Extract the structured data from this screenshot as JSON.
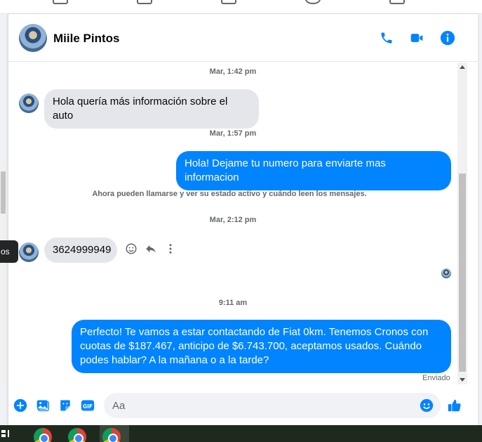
{
  "header": {
    "contact_name": "Miile Pintos",
    "icons": [
      "phone-icon",
      "video-camera-icon",
      "info-icon"
    ]
  },
  "colors": {
    "accent": "#0084ff",
    "incoming_bubble": "#e4e6eb"
  },
  "tooltip": {
    "text": "os"
  },
  "messages": {
    "t1": "Mar, 1:42 pm",
    "m1": "Hola quería más información sobre el auto",
    "t2": "Mar, 1:57 pm",
    "m2": "Hola! Dejame tu numero para enviarte mas informacion",
    "system": "Ahora pueden llamarse y ver su estado activo y cuándo leen los mensajes.",
    "t3": "Mar, 2:12 pm",
    "m3": "3624999949",
    "t4": "9:11 am",
    "m4": "Perfecto! Te vamos a estar contactando de Fiat 0km. Tenemos Cronos con cuotas de $187.467, anticipo de $6.743.700, aceptamos usados. Cuándo podes hablar? A la mañana o a la tarde?",
    "status": "Enviado"
  },
  "composer": {
    "placeholder": "Aa",
    "icons": [
      "plus-circle-icon",
      "photo-icon",
      "sticker-icon",
      "gif-icon",
      "emoji-icon",
      "thumbs-up-icon"
    ]
  }
}
